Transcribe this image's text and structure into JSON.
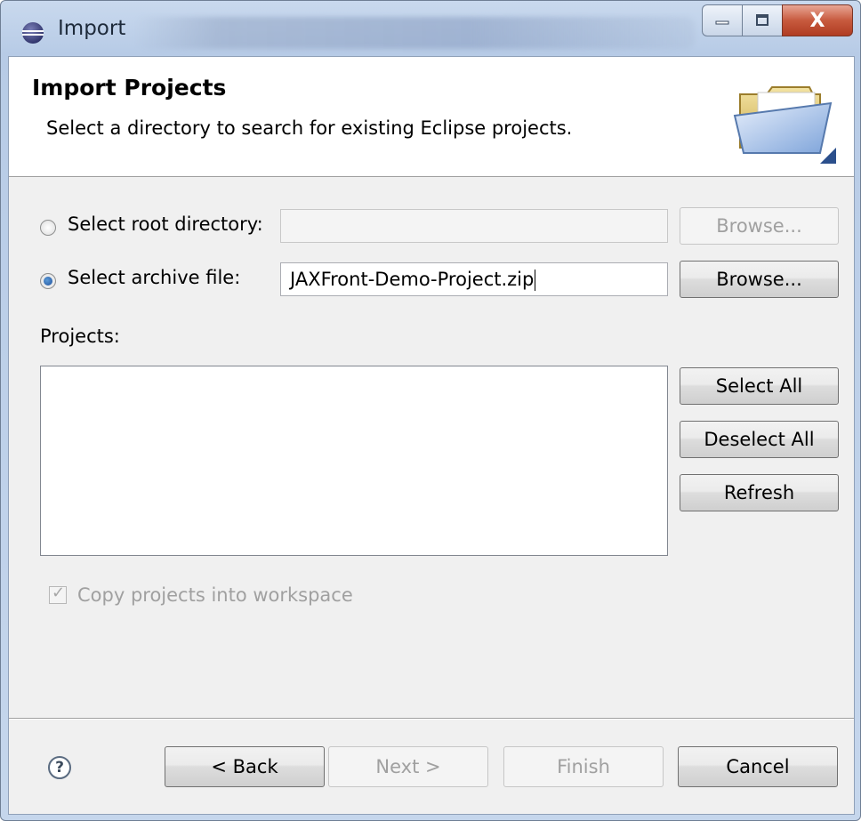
{
  "window": {
    "title": "Import",
    "icon": "eclipse-icon",
    "controls": [
      "minimize-icon",
      "maximize-icon",
      "close-icon"
    ],
    "close_glyph": "X"
  },
  "header": {
    "title": "Import Projects",
    "description": "Select a directory to search for existing Eclipse projects.",
    "icon": "folder-icon"
  },
  "source": {
    "root_directory": {
      "label": "Select root directory:",
      "selected": false,
      "value": "",
      "browse_label": "Browse...",
      "browse_enabled": false
    },
    "archive_file": {
      "label": "Select archive file:",
      "selected": true,
      "value": "JAXFront-Demo-Project.zip",
      "browse_label": "Browse...",
      "browse_enabled": true
    }
  },
  "projects": {
    "label": "Projects:",
    "items": [],
    "buttons": {
      "select_all": "Select All",
      "deselect_all": "Deselect All",
      "refresh": "Refresh"
    }
  },
  "options": {
    "copy_into_workspace": {
      "label": "Copy projects into workspace",
      "checked": true,
      "enabled": false
    }
  },
  "footer": {
    "help_glyph": "?",
    "back": "< Back",
    "next": "Next >",
    "finish": "Finish",
    "cancel": "Cancel"
  }
}
